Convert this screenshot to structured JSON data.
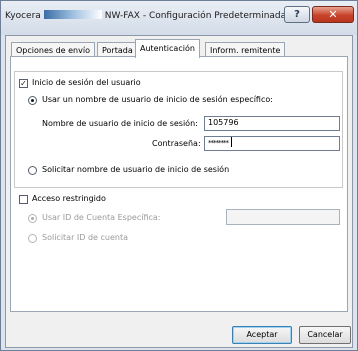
{
  "window": {
    "title_prefix": "Kyocera",
    "title_main": "NW-FAX - Configuración Predeterminada",
    "help_label": "?",
    "close_label": "✕"
  },
  "tabs": [
    {
      "label": "Opciones de envío",
      "active": false
    },
    {
      "label": "Portada",
      "active": false
    },
    {
      "label": "Autenticación",
      "active": true
    },
    {
      "label": "Inform. remitente",
      "active": false
    }
  ],
  "login": {
    "checkbox_label": "Inicio de sesión del usuario",
    "checked": true,
    "specific_user": {
      "radio_label": "Usar un nombre de usuario de inicio de sesión específico:",
      "selected": true,
      "username_label": "Nombre de usuario de inicio de sesión:",
      "username_value": "105796",
      "password_label": "Contraseña:",
      "password_value": "********"
    },
    "prompt": {
      "radio_label": "Solicitar nombre de usuario de inicio de sesión",
      "selected": false
    }
  },
  "restricted": {
    "checkbox_label": "Acceso restringido",
    "checked": false,
    "specific_account": {
      "radio_label": "Usar ID de Cuenta Específica:",
      "selected": true,
      "enabled": false,
      "value": ""
    },
    "prompt_account": {
      "radio_label": "Solicitar ID de cuenta",
      "selected": false,
      "enabled": false
    }
  },
  "buttons": {
    "ok_label": "Aceptar",
    "cancel_label": "Cancelar"
  },
  "colors": {
    "titlebar": "#dce3ec",
    "close_button": "#c8432a",
    "dialog_face": "#f0f0f0",
    "panel": "#ffffff"
  }
}
